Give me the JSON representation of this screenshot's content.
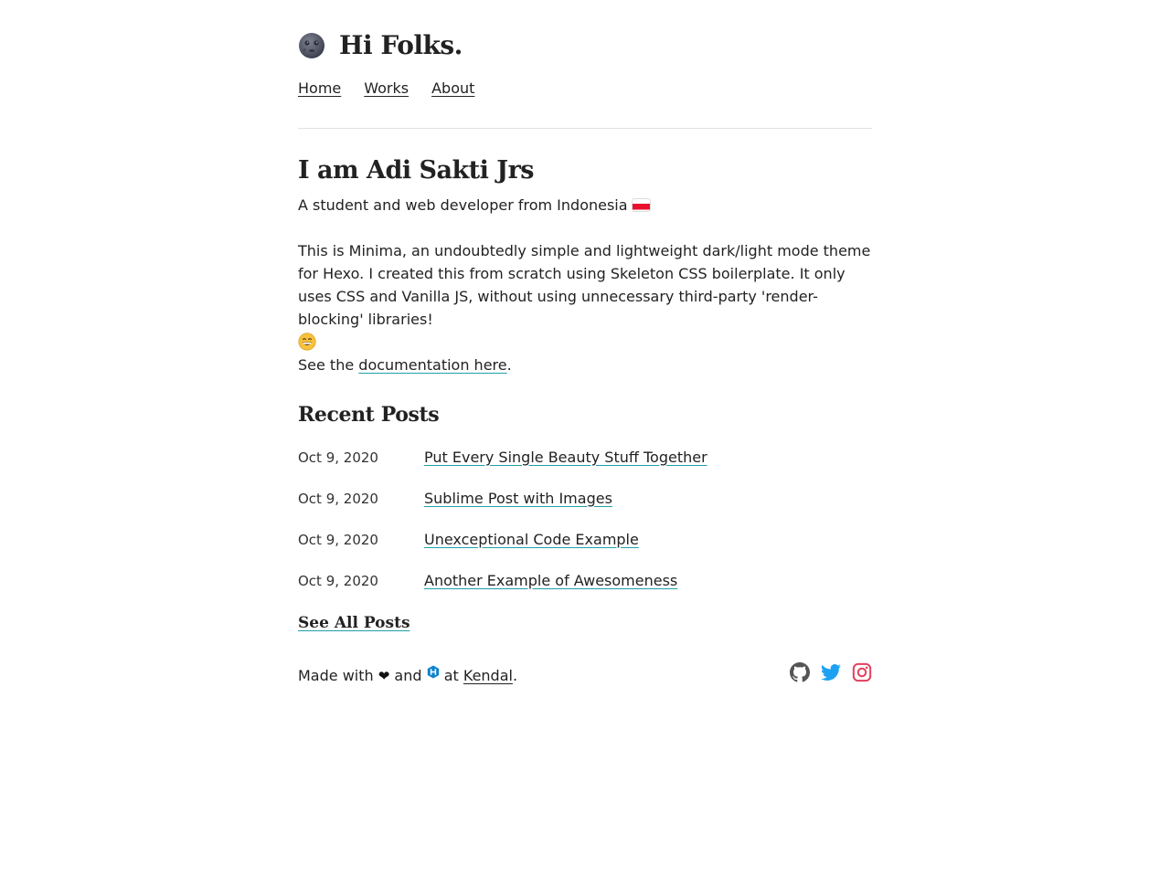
{
  "header": {
    "brand_icon": "moon-emoji-icon",
    "brand_title": "Hi Folks.",
    "nav": [
      {
        "label": "Home"
      },
      {
        "label": "Works"
      },
      {
        "label": "About"
      }
    ]
  },
  "intro": {
    "title": "I am Adi Sakti Jrs",
    "subtitle": "A student and web developer from Indonesia",
    "subtitle_icon": "indonesia-flag-icon",
    "description": "This is Minima, an undoubtedly simple and lightweight dark/light mode theme for Hexo. I created this from scratch using Skeleton CSS boilerplate. It only uses CSS and Vanilla JS, without using unnecessary third-party 'render-blocking' libraries!",
    "description_icon": "grinning-face-icon",
    "doc_prefix": "See the ",
    "doc_link": "documentation here",
    "doc_suffix": "."
  },
  "recent_posts": {
    "title": "Recent Posts",
    "posts": [
      {
        "date": "Oct 9, 2020",
        "title": "Put Every Single Beauty Stuff Together"
      },
      {
        "date": "Oct 9, 2020",
        "title": "Sublime Post with Images"
      },
      {
        "date": "Oct 9, 2020",
        "title": "Unexceptional Code Example"
      },
      {
        "date": "Oct 9, 2020",
        "title": "Another Example of Awesomeness"
      }
    ],
    "see_all": "See All Posts"
  },
  "footer": {
    "made_with": "Made with",
    "heart": "❤",
    "and": "and",
    "at": "at",
    "location_link": "Kendal",
    "period": ".",
    "social": [
      "github-icon",
      "twitter-icon",
      "instagram-icon"
    ]
  },
  "colors": {
    "text": "#222222",
    "link_underline": "#1fa0a8",
    "divider": "#e1e1e1",
    "twitter": "#1da1f2",
    "instagram": "#e4405f",
    "github": "#555555",
    "hexo": "#0e83cd"
  }
}
